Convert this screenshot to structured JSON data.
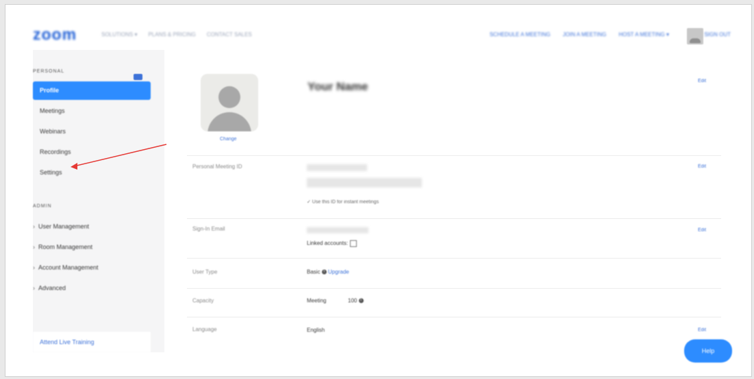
{
  "header": {
    "logo": "zoom",
    "nav_left": [
      "SOLUTIONS ▾",
      "PLANS & PRICING",
      "CONTACT SALES"
    ],
    "nav_right": [
      "SCHEDULE A MEETING",
      "JOIN A MEETING",
      "HOST A MEETING ▾"
    ],
    "sign_out": "SIGN OUT"
  },
  "sidebar": {
    "personal_label": "PERSONAL",
    "admin_label": "ADMIN",
    "personal_items": [
      "Profile",
      "Meetings",
      "Webinars",
      "Recordings",
      "Settings"
    ],
    "admin_items": [
      "User Management",
      "Room Management",
      "Account Management",
      "Advanced"
    ],
    "training": "Attend Live Training"
  },
  "profile": {
    "name": "Your Name",
    "change_label": "Change",
    "edit_label": "Edit",
    "pmi": {
      "label": "Personal Meeting ID",
      "note": "✓ Use this ID for instant meetings"
    },
    "signin": {
      "label": "Sign-In Email",
      "linked": "Linked accounts:"
    },
    "user_type": {
      "label": "User Type",
      "value": "Basic",
      "upgrade": "Upgrade"
    },
    "capacity": {
      "label": "Capacity",
      "type": "Meeting",
      "value": "100"
    },
    "language": {
      "label": "Language",
      "value": "English"
    }
  },
  "help_button": "Help",
  "annotation_color": "#e53935"
}
